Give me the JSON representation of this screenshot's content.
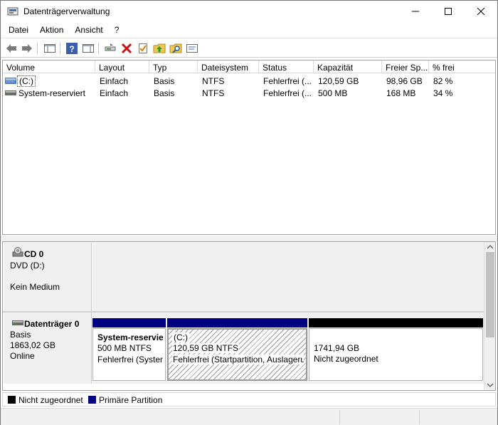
{
  "window": {
    "title": "Datenträgerverwaltung",
    "controls": [
      "minimize",
      "maximize",
      "close"
    ]
  },
  "menu": [
    "Datei",
    "Aktion",
    "Ansicht",
    "?"
  ],
  "toolbar": {
    "icons": [
      "back-arrow-icon",
      "forward-arrow-icon",
      "console-tree-icon",
      "help-icon",
      "properties-pane-icon",
      "connect-disk-icon",
      "delete-icon",
      "check-icon",
      "folder-up-icon",
      "search-folder-icon",
      "settings-icon"
    ]
  },
  "volume_list": {
    "columns": [
      "Volume",
      "Layout",
      "Typ",
      "Dateisystem",
      "Status",
      "Kapazität",
      "Freier Sp...",
      "% frei"
    ],
    "rows": [
      {
        "volume": "(C:)",
        "layout": "Einfach",
        "typ": "Basis",
        "dateisystem": "NTFS",
        "status": "Fehlerfrei (...",
        "kapazitaet": "120,59 GB",
        "frei": "98,96 GB",
        "prozent": "82 %"
      },
      {
        "volume": "System-reserviert",
        "layout": "Einfach",
        "typ": "Basis",
        "dateisystem": "NTFS",
        "status": "Fehlerfrei (...",
        "kapazitaet": "500 MB",
        "frei": "168 MB",
        "prozent": "34 %"
      }
    ]
  },
  "disks": {
    "cd": {
      "title": "CD 0",
      "line1": "DVD (D:)",
      "line2": "Kein Medium"
    },
    "disk0": {
      "title": "Datenträger 0",
      "line1": "Basis",
      "line2": "1863,02 GB",
      "line3": "Online",
      "partitions": [
        {
          "name": "System-reservie",
          "size": "500 MB NTFS",
          "status": "Fehlerfrei (Systen"
        },
        {
          "name": "(C:)",
          "size": "120,59 GB NTFS",
          "status": "Fehlerfrei (Startpartition, Auslageru"
        },
        {
          "name": "",
          "size": "1741,94 GB",
          "status": "Nicht zugeordnet"
        }
      ]
    }
  },
  "legend": [
    {
      "label": "Nicht zugeordnet",
      "color": "#000000"
    },
    {
      "label": "Primäre Partition",
      "color": "#000080"
    }
  ],
  "colors": {
    "primary_partition": "#000080",
    "unallocated": "#000000",
    "selected_hatch": "#9a9a9a"
  }
}
